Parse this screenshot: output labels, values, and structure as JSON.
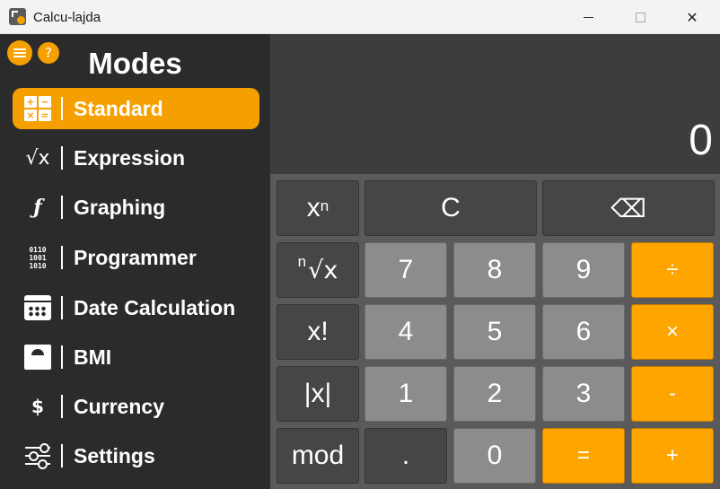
{
  "window": {
    "title": "Calcu-lajda",
    "minimize": "",
    "close": "✕"
  },
  "sidebar": {
    "title": "Modes",
    "help": "?",
    "items": [
      {
        "label": "Standard",
        "icon": "standard-grid-icon",
        "active": true
      },
      {
        "label": "Expression",
        "icon": "square-root-icon"
      },
      {
        "label": "Graphing",
        "icon": "function-icon"
      },
      {
        "label": "Programmer",
        "icon": "binary-icon"
      },
      {
        "label": "Date Calculation",
        "icon": "calendar-icon"
      },
      {
        "label": "BMI",
        "icon": "scale-icon"
      },
      {
        "label": "Currency",
        "icon": "currency-icon"
      },
      {
        "label": "Settings",
        "icon": "sliders-icon"
      }
    ],
    "icon_text": {
      "standard": [
        "+",
        "−",
        "×",
        "="
      ],
      "sqrt": "√x",
      "fx": "ƒ",
      "binary": [
        "0110",
        "1001",
        "1010"
      ],
      "currency": "$"
    }
  },
  "display": {
    "value": "0"
  },
  "keypad": {
    "power": {
      "base": "x",
      "exp": "n"
    },
    "clear": "C",
    "backspace": "⌫",
    "nth_root": {
      "index": "n",
      "rest": "√x"
    },
    "factorial": "x!",
    "abs": "|x|",
    "mod": "mod",
    "digits": {
      "0": "0",
      "1": "1",
      "2": "2",
      "3": "3",
      "4": "4",
      "5": "5",
      "6": "6",
      "7": "7",
      "8": "8",
      "9": "9"
    },
    "decimal": ".",
    "divide": "÷",
    "multiply": "×",
    "subtract": "-",
    "add": "+",
    "equals": "="
  },
  "colors": {
    "accent": "#ffa500",
    "sidebar_bg": "#2b2b2b",
    "display_bg": "#3d3d3d",
    "keypad_bg": "#5a5a5a",
    "key_dark": "#464646",
    "key_light": "#8c8c8c"
  }
}
